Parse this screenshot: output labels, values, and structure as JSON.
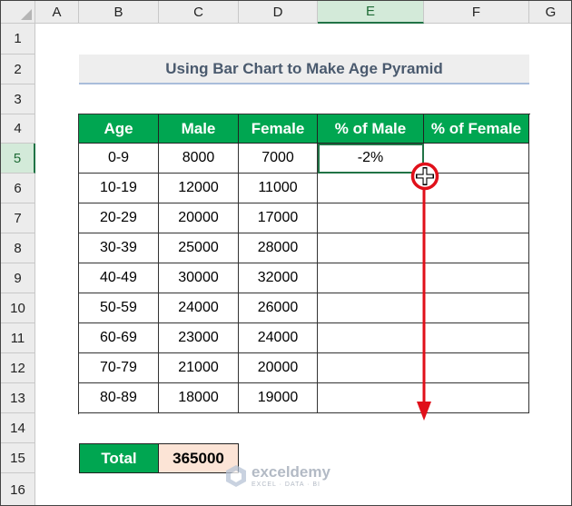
{
  "columns": [
    "A",
    "B",
    "C",
    "D",
    "E",
    "F",
    "G"
  ],
  "rows": [
    "1",
    "2",
    "3",
    "4",
    "5",
    "6",
    "7",
    "8",
    "9",
    "10",
    "11",
    "12",
    "13",
    "14",
    "15",
    "16"
  ],
  "title": "Using Bar Chart to Make Age Pyramid",
  "table": {
    "headers": [
      "Age",
      "Male",
      "Female",
      "% of Male",
      "% of Female"
    ],
    "rows": [
      [
        "0-9",
        "8000",
        "7000",
        "-2%",
        ""
      ],
      [
        "10-19",
        "12000",
        "11000",
        "",
        ""
      ],
      [
        "20-29",
        "20000",
        "17000",
        "",
        ""
      ],
      [
        "30-39",
        "25000",
        "28000",
        "",
        ""
      ],
      [
        "40-49",
        "30000",
        "32000",
        "",
        ""
      ],
      [
        "50-59",
        "24000",
        "26000",
        "",
        ""
      ],
      [
        "60-69",
        "23000",
        "24000",
        "",
        ""
      ],
      [
        "70-79",
        "21000",
        "20000",
        "",
        ""
      ],
      [
        "80-89",
        "18000",
        "19000",
        "",
        ""
      ]
    ]
  },
  "total": {
    "label": "Total",
    "value": "365000"
  },
  "selection": {
    "active_cell": "E5",
    "column": "E",
    "row": "5"
  },
  "watermark": {
    "brand": "exceldemy",
    "tagline": "EXCEL · DATA · BI"
  },
  "colors": {
    "header_green": "#00a651",
    "total_fill": "#fce4d6",
    "selection_green": "#217346",
    "annotation_red": "#e0101a",
    "title_band": "#eeeeee"
  },
  "icons": {
    "cursor": "fill-handle-crosshair-icon",
    "drag": "drag-down-arrow-icon",
    "logo": "exceldemy-logo-icon"
  }
}
